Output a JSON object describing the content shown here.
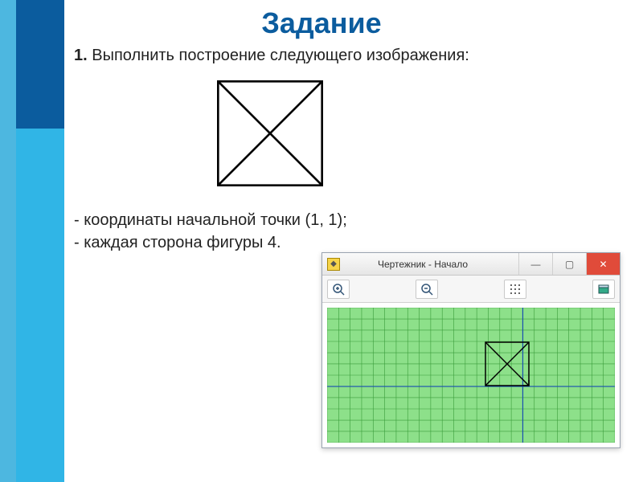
{
  "title": "Задание",
  "task": {
    "number": "1.",
    "text": "Выполнить построение следующего изображения:"
  },
  "bullets": {
    "b1": "- координаты начальной точки (1, 1);",
    "b2": "- каждая сторона фигуры 4."
  },
  "window": {
    "title": "Чертежник - Начало",
    "min": "—",
    "max": "▢",
    "close": "✕"
  },
  "grid": {
    "cols": 25,
    "rows": 12,
    "axis_col": 17,
    "axis_row": 7
  },
  "figure": {
    "description": "square-with-diagonals"
  }
}
